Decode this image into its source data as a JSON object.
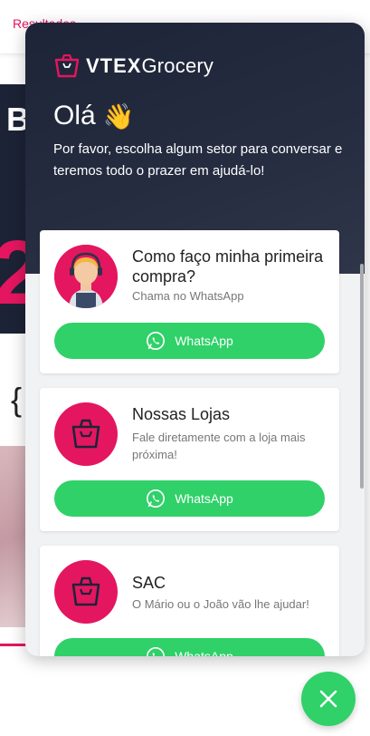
{
  "background": {
    "top_link": "Resultados",
    "hero_letter": "B",
    "hero_number": "2"
  },
  "widget": {
    "brand": {
      "part1": "VTEX",
      "part2": "Grocery"
    },
    "greeting": "Olá",
    "wave_emoji": "👋",
    "intro": "Por favor, escolha algum setor para conversar e teremos todo o prazer em ajudá-lo!",
    "cards": [
      {
        "title": "Como faço minha primeira compra?",
        "subtitle": "Chama no WhatsApp",
        "button_label": "WhatsApp",
        "avatar": "attendant-icon"
      },
      {
        "title": "Nossas Lojas",
        "subtitle": "Fale diretamente com a loja mais próxima!",
        "button_label": "WhatsApp",
        "avatar": "shopping-bag-icon"
      },
      {
        "title": "SAC",
        "subtitle": "O Mário ou o João vão lhe ajudar!",
        "button_label": "WhatsApp",
        "avatar": "shopping-bag-icon"
      }
    ]
  },
  "colors": {
    "accent": "#e4165f",
    "whatsapp": "#2fd168",
    "header_bg": "#1d2438"
  },
  "fab": {
    "icon": "close-icon"
  }
}
